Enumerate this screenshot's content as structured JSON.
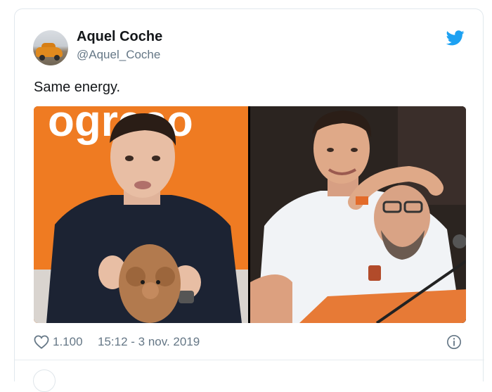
{
  "tweet": {
    "display_name": "Aquel Coche",
    "username": "@Aquel_Coche",
    "text": "Same energy.",
    "like_count": "1.100",
    "timestamp": "15:12 - 3 nov. 2019",
    "sign_left": "ogreso"
  },
  "icons": {
    "brand": "twitter-bird-icon",
    "like": "heart-icon",
    "info": "info-icon"
  },
  "colors": {
    "twitter_blue": "#1da1f2",
    "text_primary": "#14171a",
    "text_secondary": "#657786",
    "border": "#e1e8ed",
    "orange_backdrop": "#ef7b22"
  }
}
